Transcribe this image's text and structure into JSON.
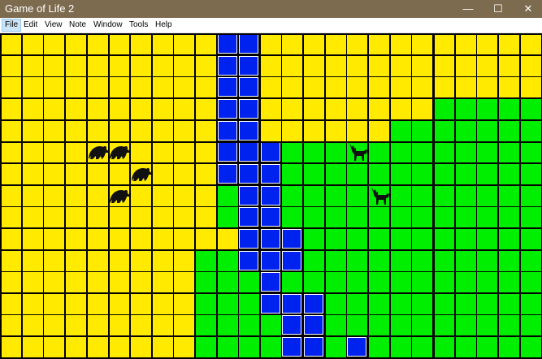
{
  "window": {
    "title": "Game of Life 2",
    "controls": {
      "minimize": "—",
      "maximize": "☐",
      "close": "✕"
    }
  },
  "menu": [
    "File",
    "Edit",
    "View",
    "Note",
    "Window",
    "Tools",
    "Help"
  ],
  "board": {
    "columns": 25,
    "rows": 15,
    "terrain_colors": {
      "Y": "#ffea00",
      "G": "#00ee00",
      "B": "#0022ee"
    },
    "grid_rows": [
      "YYYYYYYYYYBBYYYYYYYYYYYYY",
      "YYYYYYYYYYBBYYYYYYYYYYYYY",
      "YYYYYYYYYYBBYYYYYYYYYYYYY",
      "YYYYYYYYYYBBYYYYYYYYGGGGG",
      "YYYYYYYYYYBBYYYYYYGGGGGGG",
      "YYYYYYYYYYBBBGGGGGGGGGGGG",
      "YYYYYYYYYYBBBGGGGGGGGGGGG",
      "YYYYYYYYYYGBBGGGGGGGGGGGG",
      "YYYYYYYYYYGBBGGGGGGGGGGGG",
      "YYYYYYYYYYYBBBGGGGGGGGGGG",
      "YYYYYYYYYGGBBBGGGGGGGGGGG",
      "YYYYYYYYYGGGBGGGGGGGGGGGG",
      "YYYYYYYYYGGGBBBGGGGGGGGGG",
      "YYYYYYYYYGGGGBBGGGGGGGGGG",
      "YYYYYYYYYGGGGBBGBGGGGGGGG"
    ],
    "major_grid_every": 5,
    "creatures": [
      {
        "kind": "bear",
        "row": 5,
        "col": 4
      },
      {
        "kind": "bear",
        "row": 5,
        "col": 5
      },
      {
        "kind": "bear",
        "row": 6,
        "col": 6
      },
      {
        "kind": "bear",
        "row": 7,
        "col": 5
      },
      {
        "kind": "deer",
        "row": 5,
        "col": 16
      },
      {
        "kind": "deer",
        "row": 7,
        "col": 17
      }
    ]
  }
}
